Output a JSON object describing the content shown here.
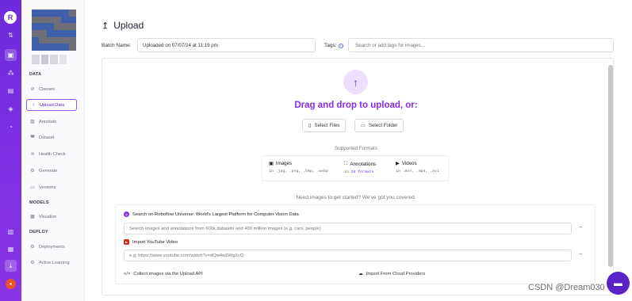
{
  "rail": {
    "icons": [
      "roboflow-logo-icon",
      "sort-icon",
      "upload-inbox-icon",
      "dataset-icon",
      "chart-icon",
      "deploy-icon",
      "bell-icon",
      "docs-icon",
      "settings-icon",
      "download-icon",
      "user-avatar"
    ]
  },
  "sidebar": {
    "sections": {
      "data": "DATA",
      "models": "MODELS",
      "deploy": "DEPLOY"
    },
    "items": [
      {
        "label": "Classes",
        "icon": "tag-icon"
      },
      {
        "label": "Upload Data",
        "icon": "upload-icon"
      },
      {
        "label": "Annotate",
        "icon": "annotate-icon"
      },
      {
        "label": "Dataset",
        "icon": "dataset-icon"
      },
      {
        "label": "Health Check",
        "icon": "health-icon"
      },
      {
        "label": "Generate",
        "icon": "generate-icon"
      },
      {
        "label": "Versions",
        "icon": "versions-icon"
      },
      {
        "label": "Visualize",
        "icon": "visualize-icon"
      },
      {
        "label": "Deployments",
        "icon": "deployments-icon"
      },
      {
        "label": "Active Learning",
        "icon": "active-learning-icon"
      }
    ]
  },
  "header": {
    "title": "Upload",
    "batch_label": "Batch Name:",
    "batch_value": "Uploaded on 07/07/24 at 11:19 pm",
    "tags_label": "Tags:",
    "tags_placeholder": "Search or add tags for images..."
  },
  "dropzone": {
    "headline": "Drag and drop to upload, or:",
    "select_files": "Select Files",
    "select_folder": "Select Folder",
    "formats_title": "Supported Formats",
    "formats": [
      {
        "name": "Images",
        "prefix": "in ",
        "detail": ".jpg, .png, .bmp, .webp"
      },
      {
        "name": "Annotations",
        "prefix": "in ",
        "detail": "26 formats"
      },
      {
        "name": "Videos",
        "prefix": "in ",
        "detail": ".mov, .mp4, .avi"
      }
    ]
  },
  "sources": {
    "intro": "Need images to get started? We've got you covered.",
    "universe_title": "Search on Roboflow Universe: World's Largest Platform for Computer Vision Data",
    "universe_placeholder": "Search images and annotations from 600k datasets and 400 million images (e.g. cars, people)",
    "youtube_title": "Import YouTube Video",
    "youtube_placeholder": "e.g. https://www.youtube.com/watch?v=dQw4w9WgXcQ",
    "api_link": "Collect images via the Upload API",
    "cloud_link": "Import From Cloud Providers"
  },
  "watermark": "CSDN @Dream030",
  "colors": {
    "brand": "#7b2fe0",
    "accent_text": "#8a2be2",
    "youtube": "#e02020"
  }
}
